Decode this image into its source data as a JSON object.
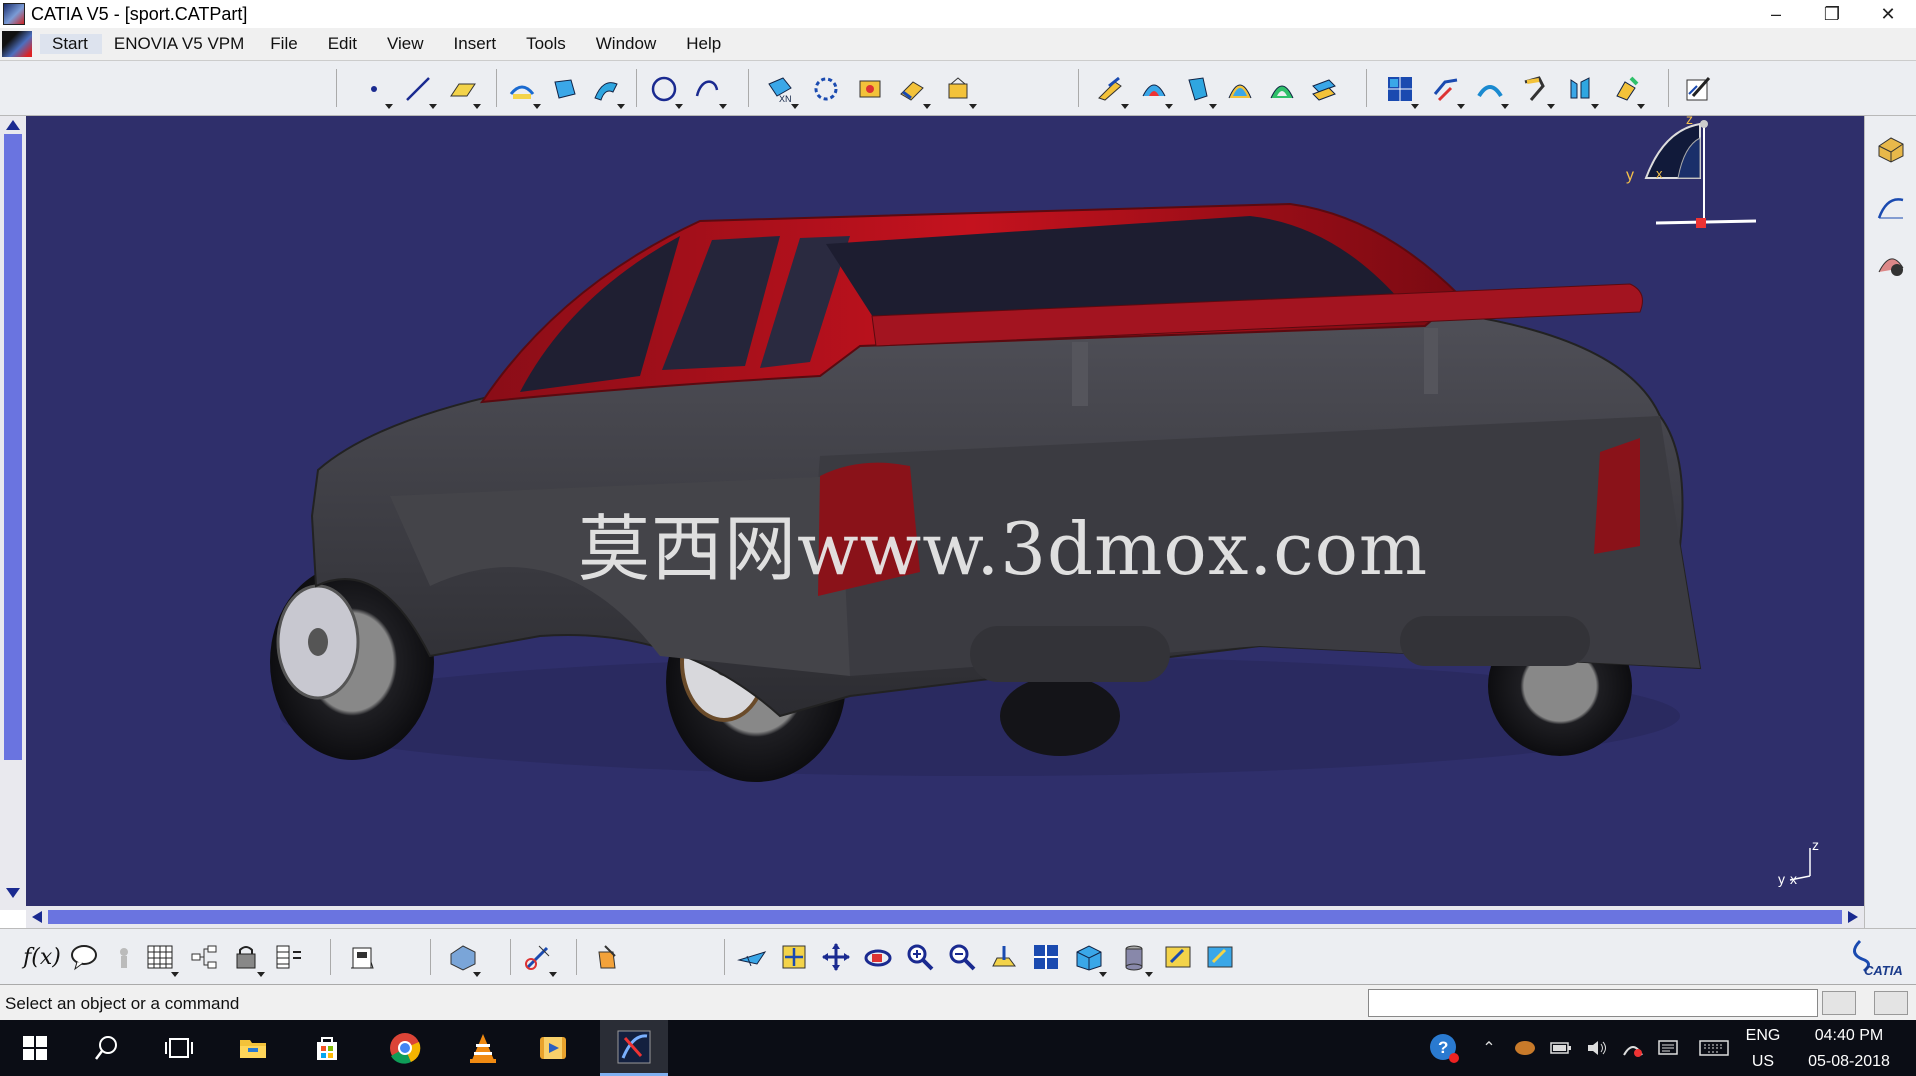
{
  "window": {
    "title": "CATIA V5 - [sport.CATPart]",
    "controls": {
      "minimize": "–",
      "restore": "❐",
      "close": "✕"
    }
  },
  "menubar": {
    "items": [
      "Start",
      "ENOVIA V5 VPM",
      "File",
      "Edit",
      "View",
      "Insert",
      "Tools",
      "Window",
      "Help"
    ],
    "child_controls": {
      "minimize": "–",
      "restore": "❐",
      "close": "✕"
    }
  },
  "toolbar_top": {
    "icons": [
      "point-icon",
      "line-icon",
      "plane-icon",
      "extrude-icon",
      "revolve-icon",
      "sweep-icon",
      "circle-icon",
      "spline-icon",
      "intersection-icon",
      "boundary-icon",
      "extract-icon",
      "join-icon",
      "healing-icon",
      "fill-icon",
      "blend-icon",
      "offset-icon",
      "loft-icon",
      "multi-section-icon",
      "split-icon",
      "grid-icon",
      "transform-icon",
      "fillet-icon",
      "chamfer-icon",
      "translate-icon",
      "symmetry-icon",
      "sketcher-icon"
    ]
  },
  "viewport": {
    "background": "#2f2f6b",
    "model": "sport car rear three-quarter view",
    "car_body_color": "#3a3a3f",
    "car_roof_color": "#b3111c",
    "compass_labels": {
      "z": "z",
      "x": "x",
      "y": "y"
    },
    "mini_axis_labels": {
      "z": "z",
      "y": "y",
      "x": "x"
    },
    "watermark": "莫西网www.3dmox.com"
  },
  "toolbar_bottom": {
    "formula_label": "f(x)",
    "icons": [
      "formula-icon",
      "comment-icon",
      "knowledge-icon",
      "table-icon",
      "tree-icon",
      "lock-icon",
      "design-table-icon",
      "catalog-icon",
      "material-icon",
      "measure-icon",
      "apply-material-icon",
      "fly-mode-icon",
      "fit-all-icon",
      "pan-icon",
      "rotate-icon",
      "zoom-in-icon",
      "zoom-out-icon",
      "normal-view-icon",
      "multi-view-icon",
      "isometric-view-icon",
      "shading-icon",
      "hide-show-icon",
      "swap-visible-icon"
    ],
    "brand": "CATIA"
  },
  "statusbar": {
    "message": "Select an object or a command",
    "command_input": ""
  },
  "taskbar": {
    "apps": [
      "windows-start-icon",
      "search-icon",
      "task-view-icon",
      "file-explorer-icon",
      "store-icon",
      "chrome-icon",
      "vlc-icon",
      "media-player-icon",
      "catia-icon"
    ],
    "language_top": "ENG",
    "language_bottom": "US",
    "time": "04:40 PM",
    "date": "05-08-2018"
  }
}
